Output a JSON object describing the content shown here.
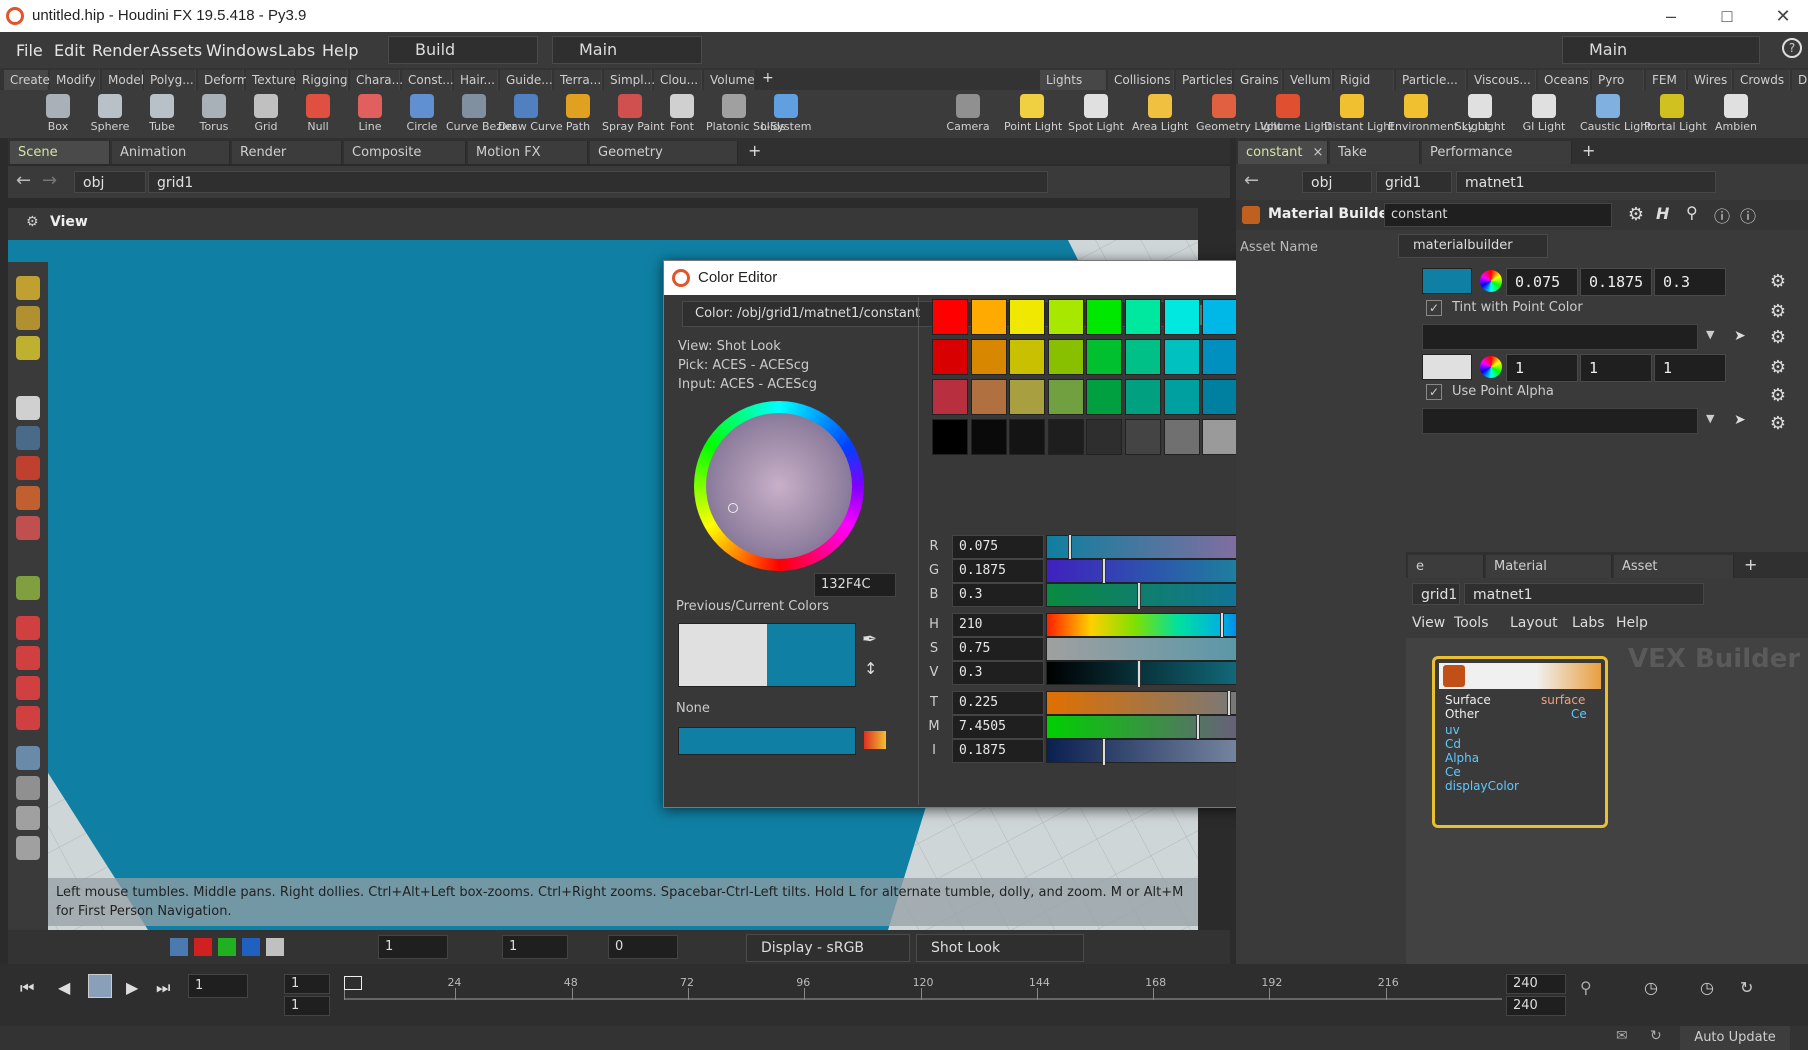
{
  "window": {
    "title": "untitled.hip - Houdini FX 19.5.418 - Py3.9"
  },
  "menubar": {
    "items": [
      "File",
      "Edit",
      "Render",
      "Assets",
      "Windows",
      "Labs",
      "Help"
    ],
    "desktop": "Build",
    "context": "Main",
    "right_context": "Main"
  },
  "shelf_tabs_left": [
    "Create",
    "Modify",
    "Model",
    "Polyg...",
    "Deform",
    "Texture",
    "Rigging",
    "Chara...",
    "Const...",
    "Hair...",
    "Guide...",
    "Terra...",
    "Simpl...",
    "Clou...",
    "Volume"
  ],
  "shelf_tabs_right": [
    "Lights a...",
    "Collisions",
    "Particles",
    "Grains",
    "Vellum",
    "Rigid B...",
    "Particle...",
    "Viscous...",
    "Oceans",
    "Pyro FX",
    "FEM",
    "Wires",
    "Crowds",
    "Drive Si..."
  ],
  "tools_left": [
    {
      "label": "Box",
      "icon": "box-icon",
      "color": "#a8b0b8"
    },
    {
      "label": "Sphere",
      "icon": "sphere-icon",
      "color": "#b8c0c8"
    },
    {
      "label": "Tube",
      "icon": "tube-icon",
      "color": "#b8c0c8"
    },
    {
      "label": "Torus",
      "icon": "torus-icon",
      "color": "#a8b0b8"
    },
    {
      "label": "Grid",
      "icon": "grid-icon",
      "color": "#c0c0c0"
    },
    {
      "label": "Null",
      "icon": "null-icon",
      "color": "#e05040"
    },
    {
      "label": "Line",
      "icon": "line-icon",
      "color": "#e06060"
    },
    {
      "label": "Circle",
      "icon": "circle-icon",
      "color": "#6090d0"
    },
    {
      "label": "Curve Bezier",
      "icon": "curve-bezier-icon",
      "color": "#8090a0"
    },
    {
      "label": "Draw Curve",
      "icon": "draw-curve-icon",
      "color": "#5080c0"
    },
    {
      "label": "Path",
      "icon": "path-icon",
      "color": "#e0a020"
    },
    {
      "label": "Spray Paint",
      "icon": "spray-paint-icon",
      "color": "#d05050"
    },
    {
      "label": "Font",
      "icon": "font-icon",
      "color": "#d0d0d0"
    },
    {
      "label": "Platonic Solids",
      "icon": "platonic-solids-icon",
      "color": "#a0a0a0"
    },
    {
      "label": "L-System",
      "icon": "l-system-icon",
      "color": "#60a0e0"
    }
  ],
  "tools_right": [
    {
      "label": "Camera",
      "icon": "camera-icon",
      "color": "#909090"
    },
    {
      "label": "Point Light",
      "icon": "point-light-icon",
      "color": "#f0d040"
    },
    {
      "label": "Spot Light",
      "icon": "spot-light-icon",
      "color": "#e0e0e0"
    },
    {
      "label": "Area Light",
      "icon": "area-light-icon",
      "color": "#f0c040"
    },
    {
      "label": "Geometry Light",
      "icon": "geometry-light-icon",
      "color": "#e06040"
    },
    {
      "label": "Volume Light",
      "icon": "volume-light-icon",
      "color": "#e05030"
    },
    {
      "label": "Distant Light",
      "icon": "distant-light-icon",
      "color": "#f0c030"
    },
    {
      "label": "Environment Light",
      "icon": "environment-light-icon",
      "color": "#f0c030"
    },
    {
      "label": "Sky Light",
      "icon": "sky-light-icon",
      "color": "#e0e0e0"
    },
    {
      "label": "GI Light",
      "icon": "gi-light-icon",
      "color": "#e0e0e0"
    },
    {
      "label": "Caustic Light",
      "icon": "caustic-light-icon",
      "color": "#80b0e0"
    },
    {
      "label": "Portal Light",
      "icon": "portal-light-icon",
      "color": "#d0c020"
    },
    {
      "label": "Ambien",
      "icon": "ambient-light-icon",
      "color": "#e0e0e0"
    }
  ],
  "left_pane": {
    "tabs": [
      "Scene View",
      "Animation Editor",
      "Render View",
      "Composite View",
      "Motion FX View",
      "Geometry Spreadsheet"
    ],
    "path": [
      "obj",
      "grid1"
    ],
    "view_label": "View",
    "hint": "Left mouse tumbles. Middle pans. Right dollies. Ctrl+Alt+Left box-zooms. Ctrl+Right zooms. Spacebar-Ctrl-Left tilts. Hold L for alternate tumble, dolly, and zoom.    M or Alt+M for First Person Navigation.",
    "bottom": {
      "field1": "1",
      "field2": "1",
      "field3": "0",
      "display": "Display - sRGB",
      "look": "Shot Look"
    }
  },
  "color_editor": {
    "title": "Color Editor",
    "color_path": "Color: /obj/grid1/matnet1/constant",
    "info": {
      "view": "View:  Shot Look",
      "pick": "Pick:  ACES - ACEScg",
      "input": "Input:  ACES - ACEScg"
    },
    "hex": "132F4C",
    "prev_current_label": "Previous/Current Colors",
    "none_label": "None",
    "previous_color": "#e0e0e0",
    "current_color": "#0f7fa3",
    "swatches": [
      [
        "#ff0000",
        "#ffaa00",
        "#f0e800",
        "#a8e800",
        "#00e800",
        "#00e8a0",
        "#00e8e0",
        "#00b8e8",
        "#0000ee",
        "#d800e8",
        "#ff00e8",
        "#ff00a0"
      ],
      [
        "#d80000",
        "#d88800",
        "#c8c000",
        "#88c000",
        "#00c030",
        "#00c088",
        "#00c0c0",
        "#0090c0",
        "#0000c8",
        "#b800c8",
        "#d800c0",
        "#d80088"
      ],
      [
        "#b83040",
        "#b07040",
        "#a8a040",
        "#70a040",
        "#00a040",
        "#00a080",
        "#00a0a0",
        "#0080a0",
        "#3040a0",
        "#8030a0",
        "#b030a0",
        "#b03080"
      ],
      [
        "#000000",
        "#0a0a0a",
        "#141414",
        "#1e1e1e",
        "#2e2e2e",
        "#444444",
        "#707070",
        "#9a9a9a",
        "#bcbcbc",
        "#cccccc",
        "#d6d6d6",
        "#e0e0e0"
      ]
    ],
    "channels": [
      {
        "label": "R",
        "value": "0.075",
        "pos": 0.06,
        "grad": "linear-gradient(90deg,#0f7f9f,#e060a0)"
      },
      {
        "label": "G",
        "value": "0.1875",
        "pos": 0.16,
        "grad": "linear-gradient(90deg,#4020c0,#00d080)"
      },
      {
        "label": "B",
        "value": "0.3",
        "pos": 0.26,
        "grad": "linear-gradient(90deg,#0a8a40,#1a60e0)"
      },
      {
        "label": "H",
        "value": "210",
        "pos": 0.5,
        "grad": "linear-gradient(90deg,#ff2000,#ffd000,#80e000,#00e0a0,#00b0e0,#0040ff,#a000ff,#ff00c0,#ff0060)"
      },
      {
        "label": "S",
        "value": "0.75",
        "pos": 0.64,
        "grad": "linear-gradient(90deg,#a0a0a0,#2090b0)"
      },
      {
        "label": "V",
        "value": "0.3",
        "pos": 0.26,
        "grad": "linear-gradient(90deg,#000000,#20c0e0)"
      },
      {
        "label": "T",
        "value": "0.225",
        "pos": 0.52,
        "grad": "linear-gradient(90deg,#e07000,#2080e0)"
      },
      {
        "label": "M",
        "value": "7.4505",
        "pos": 0.43,
        "grad": "linear-gradient(90deg,#00d000,#c000e0)"
      },
      {
        "label": "I",
        "value": "0.1875",
        "pos": 0.16,
        "grad": "linear-gradient(90deg,#0a2050,#d0d8e0)"
      }
    ]
  },
  "right_pane": {
    "tabs": [
      "constant",
      "Take List",
      "Performance Monitor"
    ],
    "path": [
      "obj",
      "grid1",
      "matnet1"
    ],
    "node_type": "Material Builder",
    "node_name": "constant",
    "asset_label": "Asset Name",
    "asset_value": "materialbuilder",
    "color1": {
      "r": "0.075",
      "g": "0.1875",
      "b": "0.3",
      "swatch": "#0f7fa3"
    },
    "tint_label": "Tint with Point Color",
    "color2": {
      "r": "1",
      "g": "1",
      "b": "1",
      "swatch": "#e0e0e0"
    },
    "alpha_label": "Use Point Alpha",
    "net_tabs": [
      "e View",
      "Material Palette",
      "Asset Browser"
    ],
    "net_path": [
      "grid1",
      "matnet1"
    ],
    "net_menu": [
      "View",
      "Tools",
      "Layout",
      "Labs",
      "Help"
    ],
    "network_type": "VEX Builder",
    "node_ports": [
      "Surface",
      "Other",
      "uv",
      "Cd",
      "Alpha",
      "Ce",
      "displayColor"
    ],
    "node_outputs": [
      "surface",
      "Ce"
    ],
    "auto_update": "Auto Update"
  },
  "timeline": {
    "frame": "1",
    "start": "1",
    "start2": "1",
    "end": "240",
    "end2": "240",
    "ticks": [
      "1",
      "24",
      "48",
      "72",
      "96",
      "120",
      "144",
      "168",
      "192",
      "216"
    ]
  }
}
